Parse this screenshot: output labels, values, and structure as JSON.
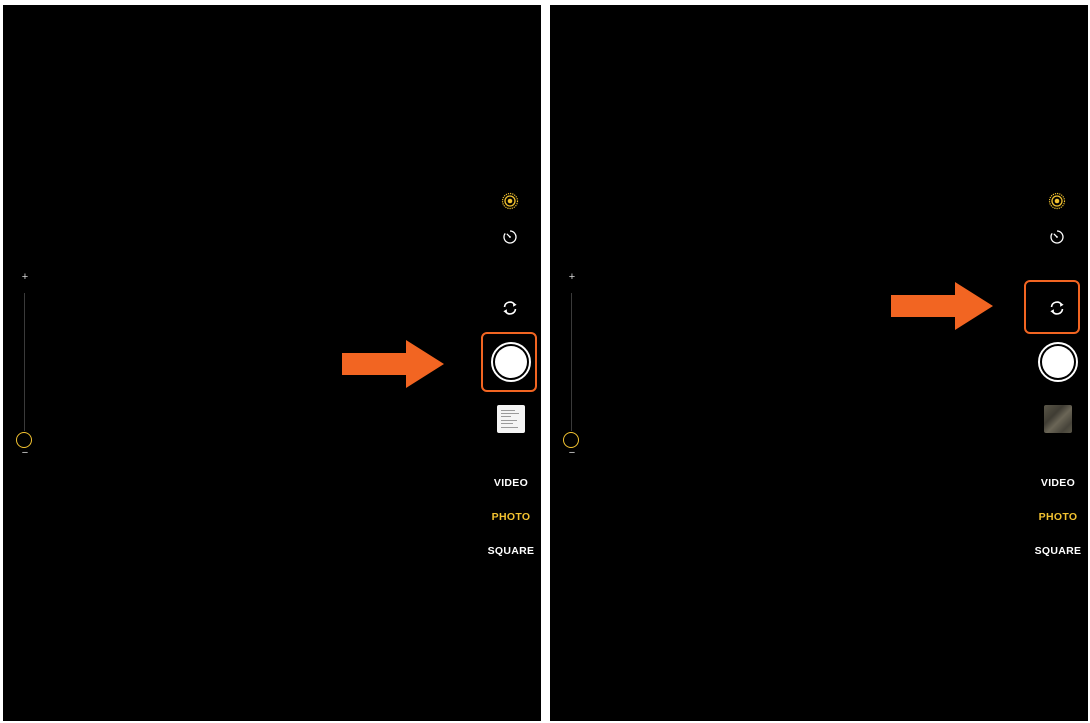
{
  "colors": {
    "accent_yellow": "#f2c230",
    "annotation_orange": "#f26522",
    "background": "#000000"
  },
  "zoom": {
    "plus_label": "+",
    "minus_label": "−"
  },
  "icons": {
    "live": "live-photo-icon",
    "timer": "timer-icon",
    "flip": "camera-flip-icon",
    "shutter": "shutter-icon"
  },
  "modes": {
    "video": "VIDEO",
    "photo": "PHOTO",
    "square": "SQUARE",
    "selected": "PHOTO"
  },
  "panels": [
    {
      "highlighted_control": "shutter-button",
      "thumbnail": "document"
    },
    {
      "highlighted_control": "flip-camera-button",
      "thumbnail": "texture"
    }
  ]
}
